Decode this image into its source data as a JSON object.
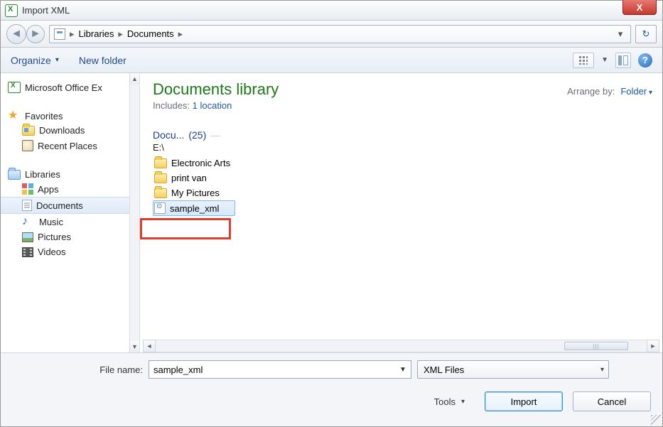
{
  "window": {
    "title": "Import XML"
  },
  "breadcrumb": {
    "root": "Libraries",
    "current": "Documents"
  },
  "toolbar": {
    "organize": "Organize",
    "newfolder": "New folder"
  },
  "sidebar": {
    "top_item": "Microsoft Office Ex",
    "favorites_label": "Favorites",
    "favorites": [
      {
        "label": "Downloads"
      },
      {
        "label": "Recent Places"
      }
    ],
    "libraries_label": "Libraries",
    "libraries": [
      {
        "label": "Apps"
      },
      {
        "label": "Documents",
        "selected": true
      },
      {
        "label": "Music"
      },
      {
        "label": "Pictures"
      },
      {
        "label": "Videos"
      }
    ]
  },
  "main": {
    "library_title": "Documents library",
    "includes_prefix": "Includes:",
    "includes_link": "1 location",
    "arrange_label": "Arrange by:",
    "arrange_value": "Folder",
    "group_name": "Docu...",
    "group_count": "(25)",
    "drive": "E:\\",
    "items": [
      {
        "label": "Electronic Arts",
        "type": "folder"
      },
      {
        "label": "print van",
        "type": "folder"
      },
      {
        "label": "My Pictures",
        "type": "folder"
      },
      {
        "label": "sample_xml",
        "type": "xml",
        "selected": true
      }
    ]
  },
  "bottom": {
    "filename_label": "File name:",
    "filename_value": "sample_xml",
    "filetype": "XML Files",
    "tools": "Tools",
    "import": "Import",
    "cancel": "Cancel"
  }
}
